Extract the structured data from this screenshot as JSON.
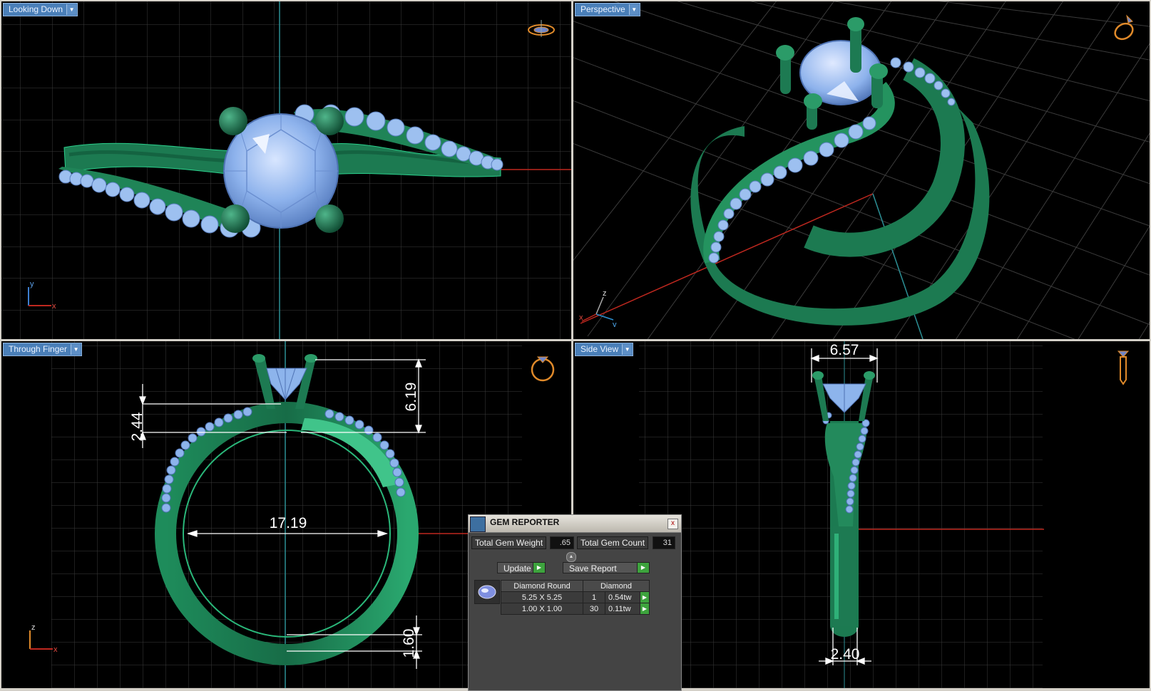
{
  "viewports": {
    "top_left": {
      "label": "Looking Down",
      "axis_v": "y",
      "axis_h": "x"
    },
    "top_right": {
      "label": "Perspective",
      "axis_v": "z",
      "axis_h": "y",
      "axis_extra": "x"
    },
    "bottom_left": {
      "label": "Through Finger",
      "axis_v": "z",
      "axis_h": "x",
      "dims": {
        "height_left": "2.44",
        "height_right": "6.19",
        "inner_diameter": "17.19",
        "band_thickness": "1.60"
      }
    },
    "bottom_right": {
      "label": "Side View",
      "dims": {
        "top_width": "6.57",
        "bottom_width": "2.40"
      }
    }
  },
  "gem_reporter": {
    "title": "GEM REPORTER",
    "close": "x",
    "total_weight_label": "Total Gem Weight",
    "total_weight_value": ".65",
    "total_count_label": "Total Gem Count",
    "total_count_value": "31",
    "update_label": "Update",
    "save_report_label": "Save Report",
    "table": {
      "header": [
        "Diamond Round",
        "Diamond"
      ],
      "rows": [
        {
          "size": "5.25 X 5.25",
          "count": "1",
          "weight": "0.54tw"
        },
        {
          "size": "1.00 X 1.00",
          "count": "30",
          "weight": "0.11tw"
        }
      ]
    }
  },
  "colors": {
    "metal": "#1d7a52",
    "gem": "#8fb5ec",
    "grid": "#3a3a3a",
    "axis_red": "#c0281f",
    "axis_cyan": "#2c8f95",
    "label_bg": "#4a7fb8",
    "orientation_icon": "#e08a2a"
  }
}
